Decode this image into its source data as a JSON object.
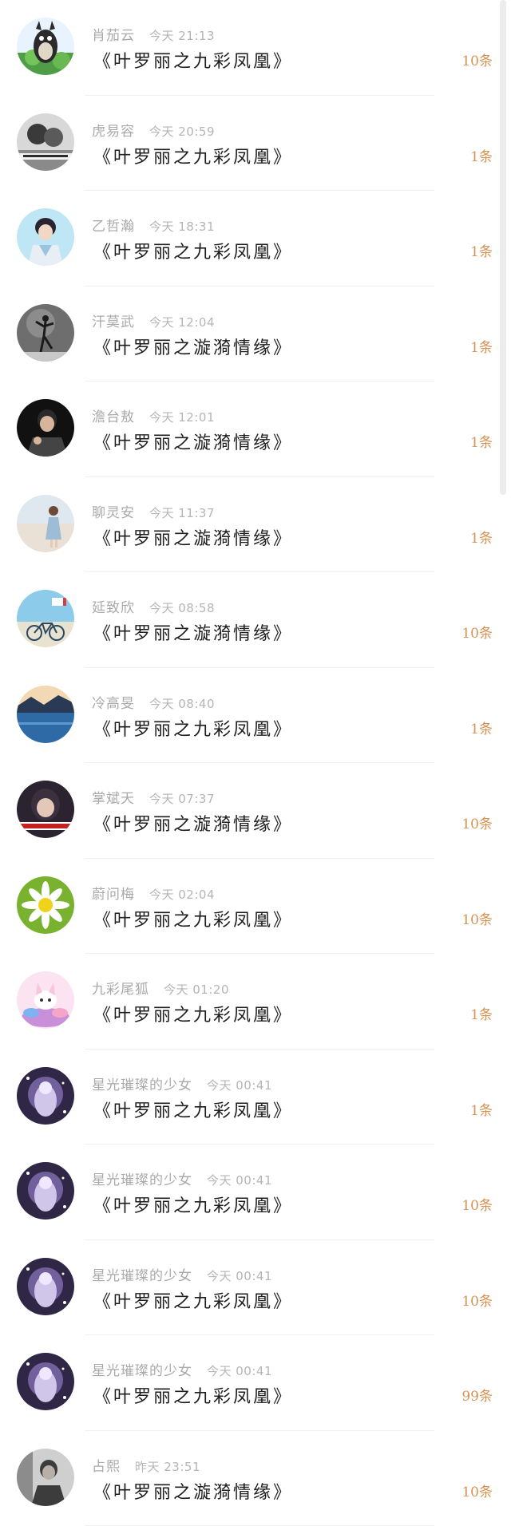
{
  "messages": [
    {
      "sender": "肖茄云",
      "time": "今天 21:13",
      "title": "《叶罗丽之九彩凤凰》",
      "count": "10条",
      "avatar": "totoro-avatar",
      "colors": [
        "#4f9d46",
        "#2b2b2b",
        "#e8f3ff"
      ]
    },
    {
      "sender": "虎易容",
      "time": "今天 20:59",
      "title": "《叶罗丽之九彩凤凰》",
      "count": "1条",
      "avatar": "couple-avatar",
      "colors": [
        "#d8d8d8",
        "#3a3a3a",
        "#8a8a8a"
      ]
    },
    {
      "sender": "乙哲瀚",
      "time": "今天 18:31",
      "title": "《叶罗丽之九彩凤凰》",
      "count": "1条",
      "avatar": "boy-avatar",
      "colors": [
        "#bfe6f5",
        "#2a2430",
        "#f1d7c4"
      ]
    },
    {
      "sender": "汗莫武",
      "time": "今天 12:04",
      "title": "《叶罗丽之漩漪情缘》",
      "count": "1条",
      "avatar": "dancer-avatar",
      "colors": [
        "#6e6e6e",
        "#1b1b1b",
        "#c8c8c8"
      ]
    },
    {
      "sender": "澹台敖",
      "time": "今天 12:01",
      "title": "《叶罗丽之漩漪情缘》",
      "count": "1条",
      "avatar": "man-dark-avatar",
      "colors": [
        "#111111",
        "#444444",
        "#d7b59c"
      ]
    },
    {
      "sender": "聊灵安",
      "time": "今天 11:37",
      "title": "《叶罗丽之漩漪情缘》",
      "count": "1条",
      "avatar": "beach-girl-avatar",
      "colors": [
        "#e9e0d6",
        "#c9aca4",
        "#9fbcd6"
      ]
    },
    {
      "sender": "延致欣",
      "time": "今天 08:58",
      "title": "《叶罗丽之漩漪情缘》",
      "count": "10条",
      "avatar": "bicycle-avatar",
      "colors": [
        "#8ccbe9",
        "#e8e2d0",
        "#2a4a63"
      ]
    },
    {
      "sender": "冷高旻",
      "time": "今天 08:40",
      "title": "《叶罗丽之九彩凤凰》",
      "count": "1条",
      "avatar": "lake-avatar",
      "colors": [
        "#2d6aa6",
        "#f3d9b3",
        "#2a3a55"
      ]
    },
    {
      "sender": "掌斌天",
      "time": "今天 07:37",
      "title": "《叶罗丽之漩漪情缘》",
      "count": "10条",
      "avatar": "girl-banner-avatar",
      "colors": [
        "#2b2430",
        "#c22222",
        "#e4c7b8"
      ]
    },
    {
      "sender": "蔚问梅",
      "time": "今天 02:04",
      "title": "《叶罗丽之九彩凤凰》",
      "count": "10条",
      "avatar": "daisy-avatar",
      "colors": [
        "#79b22e",
        "#ffffff",
        "#f0d21b"
      ]
    },
    {
      "sender": "九彩尾狐",
      "time": "今天 01:20",
      "title": "《叶罗丽之九彩凤凰》",
      "count": "1条",
      "avatar": "fox-avatar",
      "colors": [
        "#fbe3f1",
        "#c98fd9",
        "#7fb2f0"
      ]
    },
    {
      "sender": "星光璀璨的少女",
      "time": "今天 00:41",
      "title": "《叶罗丽之九彩凤凰》",
      "count": "1条",
      "avatar": "starry-girl-avatar",
      "colors": [
        "#2f2745",
        "#cfc6ea",
        "#8f79c2"
      ]
    },
    {
      "sender": "星光璀璨的少女",
      "time": "今天 00:41",
      "title": "《叶罗丽之九彩凤凰》",
      "count": "10条",
      "avatar": "starry-girl-avatar",
      "colors": [
        "#2f2745",
        "#cfc6ea",
        "#8f79c2"
      ]
    },
    {
      "sender": "星光璀璨的少女",
      "time": "今天 00:41",
      "title": "《叶罗丽之九彩凤凰》",
      "count": "10条",
      "avatar": "starry-girl-avatar",
      "colors": [
        "#2f2745",
        "#cfc6ea",
        "#8f79c2"
      ]
    },
    {
      "sender": "星光璀璨的少女",
      "time": "今天 00:41",
      "title": "《叶罗丽之九彩凤凰》",
      "count": "99条",
      "avatar": "starry-girl-avatar",
      "colors": [
        "#2f2745",
        "#cfc6ea",
        "#8f79c2"
      ]
    },
    {
      "sender": "占熙",
      "time": "昨天 23:51",
      "title": "《叶罗丽之漩漪情缘》",
      "count": "10条",
      "avatar": "man-grey-avatar",
      "colors": [
        "#8c8c8c",
        "#3c3c3c",
        "#cfcfcf"
      ]
    }
  ],
  "theme": {
    "accent": "#d89253",
    "name": "#a9a9a9",
    "title": "#1e1e1e",
    "divider": "#f0f0f0"
  }
}
